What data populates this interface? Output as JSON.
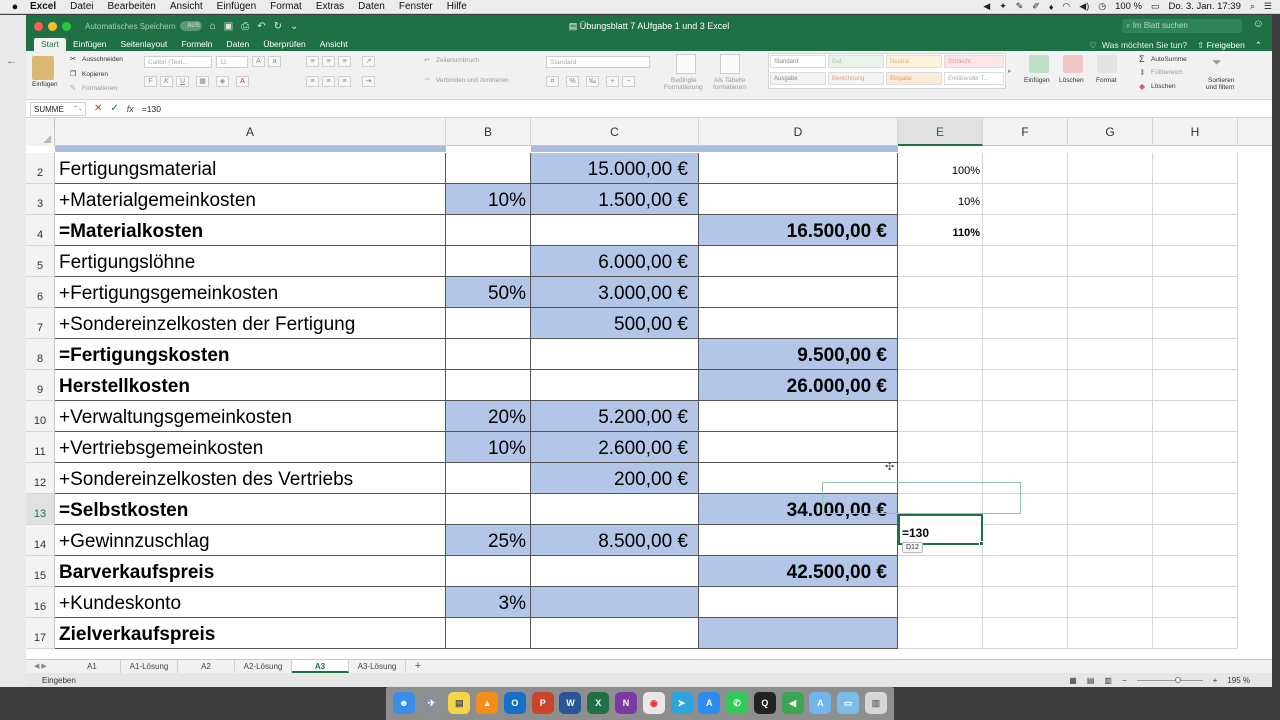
{
  "menubar": {
    "app": "Excel",
    "items": [
      "Datei",
      "Bearbeiten",
      "Ansicht",
      "Einfügen",
      "Format",
      "Extras",
      "Daten",
      "Fenster",
      "Hilfe"
    ],
    "battery": "100 %",
    "clock": "Do. 3. Jan.  17:39"
  },
  "titlebar": {
    "autosave_label": "Automatisches Speichern",
    "autosave_state": "AUS",
    "doc_title": "Übungsblatt 7 AUfgabe 1 und 3 Excel",
    "search_placeholder": "Im Blatt suchen"
  },
  "ribbon_tabs": [
    "Start",
    "Einfügen",
    "Seitenlayout",
    "Formeln",
    "Daten",
    "Überprüfen",
    "Ansicht"
  ],
  "tell_me": "Was möchten Sie tun?",
  "share": "Freigeben",
  "ribbon": {
    "paste": "Einfügen",
    "cut": "Ausschneiden",
    "copy": "Kopieren",
    "format_painter": "Formatieren",
    "font_name": "Calibri (Text...",
    "font_size": "11",
    "wrap": "Zeilenumbruch",
    "merge": "Verbinden und zentrieren",
    "number_format": "Standard",
    "cond_format_1": "Bedingte",
    "cond_format_2": "Formatierung",
    "as_table_1": "Als Tabelle",
    "as_table_2": "formatieren",
    "styles": [
      "Standard",
      "Gut",
      "Neutral",
      "Schlecht",
      "Ausgabe",
      "Berechnung",
      "Eingabe",
      "Erklärender T..."
    ],
    "insert": "Einfügen",
    "delete": "Löschen",
    "format": "Format",
    "autosum": "AutoSumme",
    "fill": "Füllbereich",
    "clear": "Löschen",
    "sort_1": "Sortieren",
    "sort_2": "und filtern"
  },
  "formula_bar": {
    "name_box": "SUMME",
    "cancel": "✕",
    "enter": "✓",
    "fx": "fx",
    "content": "=130"
  },
  "columns": [
    "A",
    "B",
    "C",
    "D",
    "E",
    "F",
    "G",
    "H"
  ],
  "rows": [
    {
      "num": "2",
      "a": "Fertigungsmaterial",
      "b": "",
      "c": "15.000,00 €",
      "d": "",
      "e": "100%"
    },
    {
      "num": "3",
      "a": "+Materialgemeinkosten",
      "b": "10%",
      "c": "1.500,00 €",
      "d": "",
      "e": "10%"
    },
    {
      "num": "4",
      "a": "=Materialkosten",
      "b": "",
      "c": "",
      "d": "16.500,00 €",
      "e": "110%"
    },
    {
      "num": "5",
      "a": "Fertigungslöhne",
      "b": "",
      "c": "6.000,00 €",
      "d": "",
      "e": ""
    },
    {
      "num": "6",
      "a": "+Fertigungsgemeinkosten",
      "b": "50%",
      "c": "3.000,00 €",
      "d": "",
      "e": ""
    },
    {
      "num": "7",
      "a": "+Sondereinzelkosten der Fertigung",
      "b": "",
      "c": "500,00 €",
      "d": "",
      "e": ""
    },
    {
      "num": "8",
      "a": "=Fertigungskosten",
      "b": "",
      "c": "",
      "d": "9.500,00 €",
      "e": ""
    },
    {
      "num": "9",
      "a": "Herstellkosten",
      "b": "",
      "c": "",
      "d": "26.000,00 €",
      "e": ""
    },
    {
      "num": "10",
      "a": "+Verwaltungsgemeinkosten",
      "b": "20%",
      "c": "5.200,00 €",
      "d": "",
      "e": ""
    },
    {
      "num": "11",
      "a": "+Vertriebsgemeinkosten",
      "b": "10%",
      "c": "2.600,00 €",
      "d": "",
      "e": ""
    },
    {
      "num": "12",
      "a": "+Sondereinzelkosten des Vertriebs",
      "b": "",
      "c": "200,00 €",
      "d": "",
      "e": ""
    },
    {
      "num": "13",
      "a": "=Selbstkosten",
      "b": "",
      "c": "",
      "d": "34.000,00 €",
      "e": ""
    },
    {
      "num": "14",
      "a": "+Gewinnzuschlag",
      "b": "25%",
      "c": "8.500,00 €",
      "d": "",
      "e": ""
    },
    {
      "num": "15",
      "a": "Barverkaufspreis",
      "b": "",
      "c": "",
      "d": "42.500,00 €",
      "e": ""
    },
    {
      "num": "16",
      "a": "+Kundeskonto",
      "b": "3%",
      "c": "",
      "d": "",
      "e": ""
    },
    {
      "num": "17",
      "a": "Zielverkaufspreis",
      "b": "",
      "c": "",
      "d": "",
      "e": ""
    }
  ],
  "active_cell": {
    "content": "=130",
    "ref_tooltip": "D12"
  },
  "sheet_tabs": [
    "A1",
    "A1-Lösung",
    "A2",
    "A2-Lösung",
    "A3",
    "A3-Lösung"
  ],
  "active_sheet": "A3",
  "status": {
    "mode": "Eingeben",
    "zoom": "195 %"
  },
  "dock_apps": [
    "Finder",
    "Launchpad",
    "Notizzettel",
    "VLC",
    "Outlook",
    "PowerPoint",
    "Word",
    "Excel",
    "OneNote",
    "Chrome",
    "Telegram",
    "App Store",
    "WhatsApp",
    "QuickTime",
    "Bildschirmfreigabe",
    "Programme",
    "Dokumente",
    "Papierkorb"
  ]
}
